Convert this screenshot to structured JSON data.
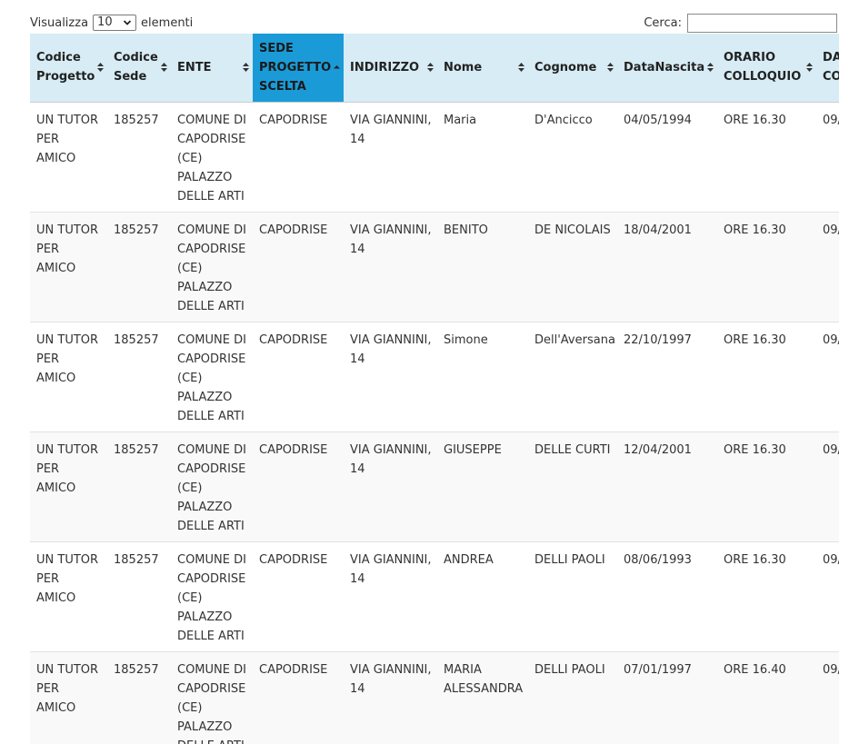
{
  "controls": {
    "length_prefix": "Visualizza",
    "length_value": "10",
    "length_suffix": "elementi",
    "search_label": "Cerca:",
    "search_value": ""
  },
  "table": {
    "sorted_column": "SEDE PROGETTO SCELTA",
    "headers": [
      "Codice Progetto",
      "Codice Sede",
      "ENTE",
      "SEDE PROGETTO SCELTA",
      "INDIRIZZO",
      "Nome",
      "Cognome",
      "DataNascita",
      "ORARIO COLLOQUIO",
      "DATA COLLOQUIO"
    ],
    "rows": [
      [
        "UN TUTOR PER AMICO",
        "185257",
        "COMUNE DI CAPODRISE (CE) PALAZZO DELLE ARTI",
        "CAPODRISE",
        "VIA GIANNINI, 14",
        "Maria",
        "D'Ancicco",
        "04/05/1994",
        "ORE 16.30",
        "09/"
      ],
      [
        "UN TUTOR PER AMICO",
        "185257",
        "COMUNE DI CAPODRISE (CE) PALAZZO DELLE ARTI",
        "CAPODRISE",
        "VIA GIANNINI, 14",
        "BENITO",
        "DE NICOLAIS",
        "18/04/2001",
        "ORE 16.30",
        "09/"
      ],
      [
        "UN TUTOR PER AMICO",
        "185257",
        "COMUNE DI CAPODRISE (CE) PALAZZO DELLE ARTI",
        "CAPODRISE",
        "VIA GIANNINI, 14",
        "Simone",
        "Dell'Aversana",
        "22/10/1997",
        "ORE 16.30",
        "09/"
      ],
      [
        "UN TUTOR PER AMICO",
        "185257",
        "COMUNE DI CAPODRISE (CE) PALAZZO DELLE ARTI",
        "CAPODRISE",
        "VIA GIANNINI, 14",
        "GIUSEPPE",
        "DELLE CURTI",
        "12/04/2001",
        "ORE 16.30",
        "09/"
      ],
      [
        "UN TUTOR PER AMICO",
        "185257",
        "COMUNE DI CAPODRISE (CE) PALAZZO DELLE ARTI",
        "CAPODRISE",
        "VIA GIANNINI, 14",
        "ANDREA",
        "DELLI PAOLI",
        "08/06/1993",
        "ORE 16.30",
        "09/"
      ],
      [
        "UN TUTOR PER AMICO",
        "185257",
        "COMUNE DI CAPODRISE (CE) PALAZZO DELLE ARTI",
        "CAPODRISE",
        "VIA GIANNINI, 14",
        "MARIA ALESSANDRA",
        "DELLI PAOLI",
        "07/01/1997",
        "ORE 16.40",
        "09/"
      ]
    ]
  }
}
